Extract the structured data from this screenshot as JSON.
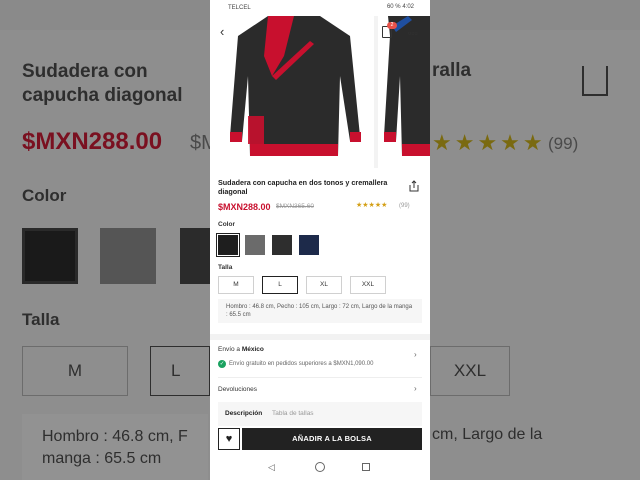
{
  "status_bar": {
    "carrier": "TELCEL",
    "battery": "60 %",
    "time": "4:02"
  },
  "header": {
    "bag_count": "2"
  },
  "product": {
    "title": "Sudadera con capucha en dos tonos y cremallera diagonal",
    "price": "$MXN288.00",
    "old_price": "$MXN365.60",
    "stars": "★★★★★",
    "reviews": "(99)"
  },
  "color": {
    "label": "Color",
    "swatches": [
      "black",
      "gray",
      "black-gray",
      "black-blue"
    ],
    "selected": 0
  },
  "size": {
    "label": "Talla",
    "options": [
      "M",
      "L",
      "XL",
      "XXL"
    ],
    "selected": "L"
  },
  "measurements": "Hombro :  46.8 cm, Pecho :  105 cm, Largo :  72 cm, Largo de la manga :  65.5 cm",
  "shipping": {
    "prefix": "Envío a ",
    "country": "México",
    "note": "Envío gratuito en pedidos superiores a $MXN1,090.00"
  },
  "returns_label": "Devoluciones",
  "tabs": {
    "description": "Descripción",
    "size_chart": "Tabla de tallas"
  },
  "cta": {
    "add_to_bag": "AÑADIR A LA BOLSA"
  },
  "background": {
    "title": "Sudadera con capucha diagonal",
    "price": "$MXN288.00",
    "old_price": "$M",
    "color_label": "Color",
    "size_label": "Talla",
    "sizes": [
      "M",
      "L",
      "XXL"
    ],
    "measure_left": "Hombro :  46.8 cm, F",
    "measure_left_2": "manga :  65.5 cm",
    "right_title": "ralla",
    "stars": "★★★★★",
    "reviews": "(99)",
    "measure_right": "cm, Largo de la"
  },
  "colors": {
    "accent": "#c8102e",
    "dark": "#222222",
    "star": "#d4a017",
    "check": "#1aa260"
  }
}
